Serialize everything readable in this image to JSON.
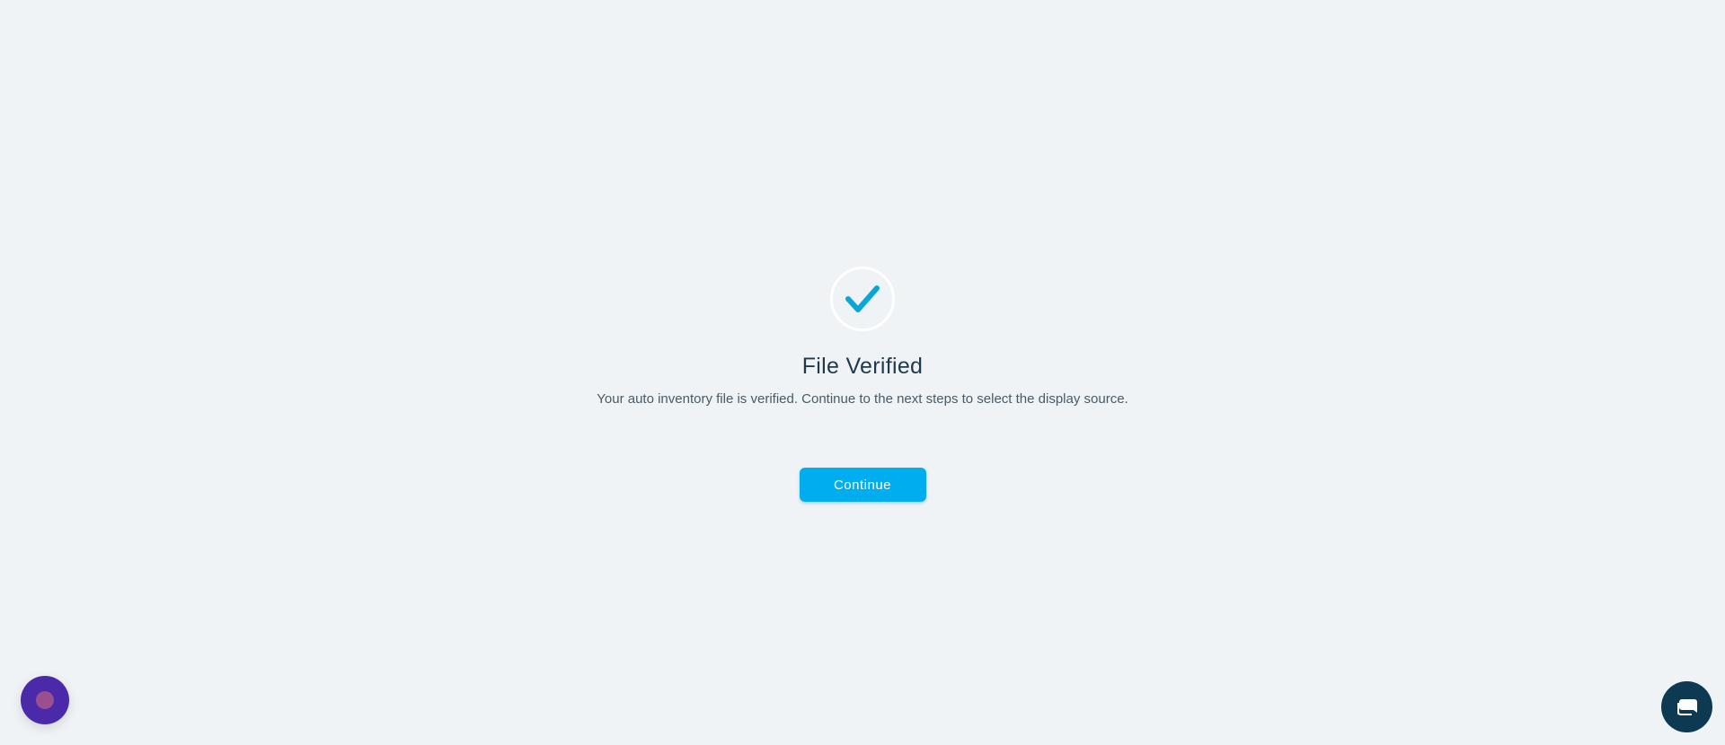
{
  "main": {
    "title": "File Verified",
    "message": "Your auto inventory file is verified. Continue to the next steps to select the display source.",
    "continue_label": "Continue"
  },
  "icons": {
    "status": "checkmark-icon",
    "assistant": "assistant-launcher-icon",
    "chat": "chat-icon"
  },
  "colors": {
    "background": "#eff3f5",
    "accent": "#00aef0",
    "check": "#0ba5d6",
    "title_text": "#1f3a4d",
    "chat_button": "#0d3a52",
    "assistant_button": "#4a2aa8"
  }
}
